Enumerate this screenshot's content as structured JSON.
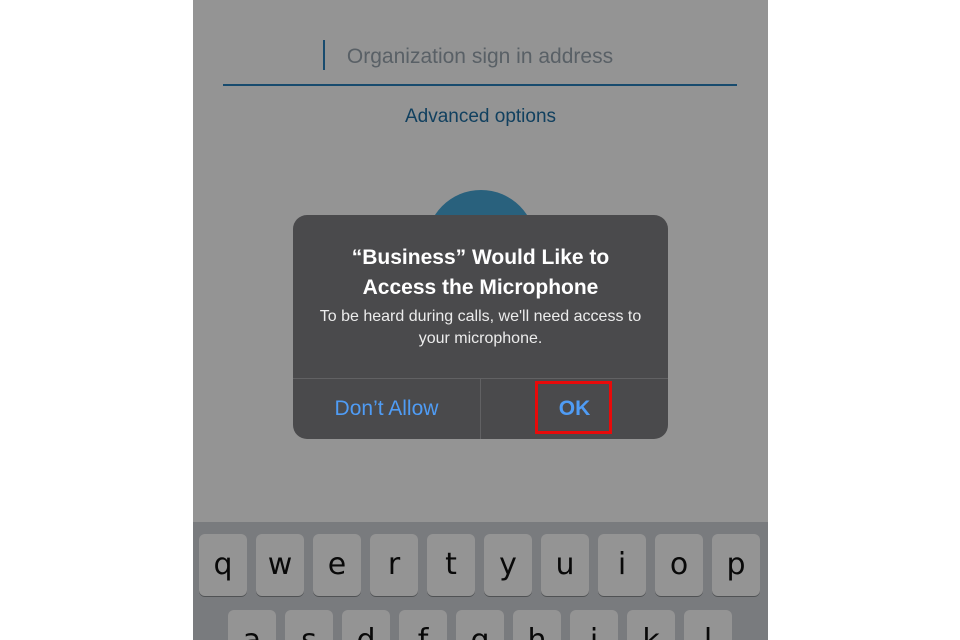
{
  "background_screen": {
    "signin_placeholder": "Organization sign in address",
    "advanced_options": "Advanced options"
  },
  "keyboard": {
    "row1": [
      "q",
      "w",
      "e",
      "r",
      "t",
      "y",
      "u",
      "i",
      "o",
      "p"
    ],
    "row2": [
      "a",
      "s",
      "d",
      "f",
      "g",
      "h",
      "j",
      "k",
      "l"
    ]
  },
  "alert": {
    "title": "“Business” Would Like to Access the Microphone",
    "message": "To be heard during calls, we'll need access to your microphone.",
    "deny_label": "Don’t Allow",
    "ok_label": "OK"
  },
  "colors": {
    "accent_blue": "#2a82bd",
    "alert_button_blue": "#4f9cf5",
    "highlight_red": "#e80a0a",
    "alert_background": "#4a4a4c"
  }
}
